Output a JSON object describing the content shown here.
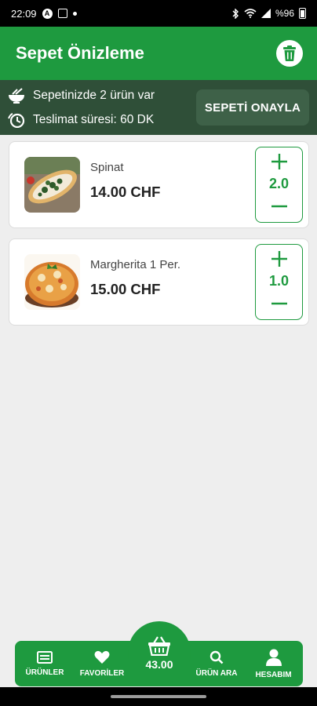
{
  "status_bar": {
    "time": "22:09",
    "notification_letter": "A",
    "battery": "%96",
    "icons": [
      "assistant-icon",
      "gallery-icon",
      "dot-icon",
      "bluetooth-icon",
      "wifi-icon",
      "signal-icon",
      "battery-icon"
    ]
  },
  "app_bar": {
    "title": "Sepet Önizleme",
    "trash_icon": "trash-icon"
  },
  "summary": {
    "items_text": "Sepetinizde 2 ürün var",
    "delivery_text": "Teslimat süresi: 60 DK",
    "confirm_label": "SEPETİ ONAYLA"
  },
  "cart": {
    "items": [
      {
        "name": "Spinat",
        "price": "14.00 CHF",
        "quantity": "2.0",
        "image": "spinach-pide"
      },
      {
        "name": "Margherita 1 Per.",
        "price": "15.00 CHF",
        "quantity": "1.0",
        "image": "margherita-pizza"
      }
    ]
  },
  "bottom_nav": {
    "products": "ÜRÜNLER",
    "favorites": "FAVORİLER",
    "total": "43.00",
    "search": "ÜRÜN ARA",
    "account": "HESABIM"
  },
  "colors": {
    "primary": "#1e9a3f",
    "info_bar": "#2f4f38",
    "confirm_button": "#3e6148",
    "background": "#eeeeee"
  }
}
